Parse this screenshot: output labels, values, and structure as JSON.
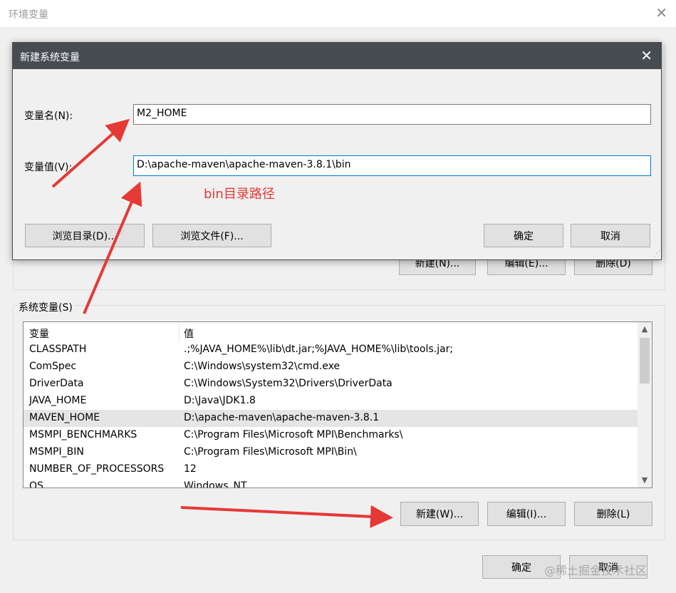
{
  "outer_window": {
    "title": "环境变量",
    "close_glyph": "✕",
    "user_buttons": {
      "new": "新建(N)...",
      "edit": "编辑(E)...",
      "delete": "删除(D)"
    },
    "system_section": {
      "label": "系统变量(S)",
      "columns": [
        "变量",
        "值"
      ],
      "rows": [
        {
          "name": "CLASSPATH",
          "value": ".;%JAVA_HOME%\\lib\\dt.jar;%JAVA_HOME%\\lib\\tools.jar;"
        },
        {
          "name": "ComSpec",
          "value": "C:\\Windows\\system32\\cmd.exe"
        },
        {
          "name": "DriverData",
          "value": "C:\\Windows\\System32\\Drivers\\DriverData"
        },
        {
          "name": "JAVA_HOME",
          "value": "D:\\Java\\JDK1.8"
        },
        {
          "name": "MAVEN_HOME",
          "value": "D:\\apache-maven\\apache-maven-3.8.1",
          "selected": true
        },
        {
          "name": "MSMPI_BENCHMARKS",
          "value": "C:\\Program Files\\Microsoft MPI\\Benchmarks\\"
        },
        {
          "name": "MSMPI_BIN",
          "value": "C:\\Program Files\\Microsoft MPI\\Bin\\"
        },
        {
          "name": "NUMBER_OF_PROCESSORS",
          "value": "12"
        },
        {
          "name": "OS",
          "value": "Windows_NT"
        }
      ],
      "buttons": {
        "new": "新建(W)...",
        "edit": "编辑(I)...",
        "delete": "删除(L)"
      }
    },
    "footer_buttons": {
      "ok": "确定",
      "cancel": "取消"
    }
  },
  "dialog": {
    "title": "新建系统变量",
    "close_glyph": "✕",
    "name_label": "变量名(N):",
    "name_value": "M2_HOME",
    "value_label": "变量值(V):",
    "value_value": "D:\\apache-maven\\apache-maven-3.8.1\\bin",
    "browse_dir": "浏览目录(D)...",
    "browse_file": "浏览文件(F)...",
    "ok": "确定",
    "cancel": "取消",
    "resize_grip": "⋰"
  },
  "annotation": {
    "text": "bin目录路径",
    "color": "#e53935"
  },
  "watermark": "@稀土掘金技术社区",
  "icons": {
    "scroll_up": "▲",
    "scroll_down": "▼"
  }
}
